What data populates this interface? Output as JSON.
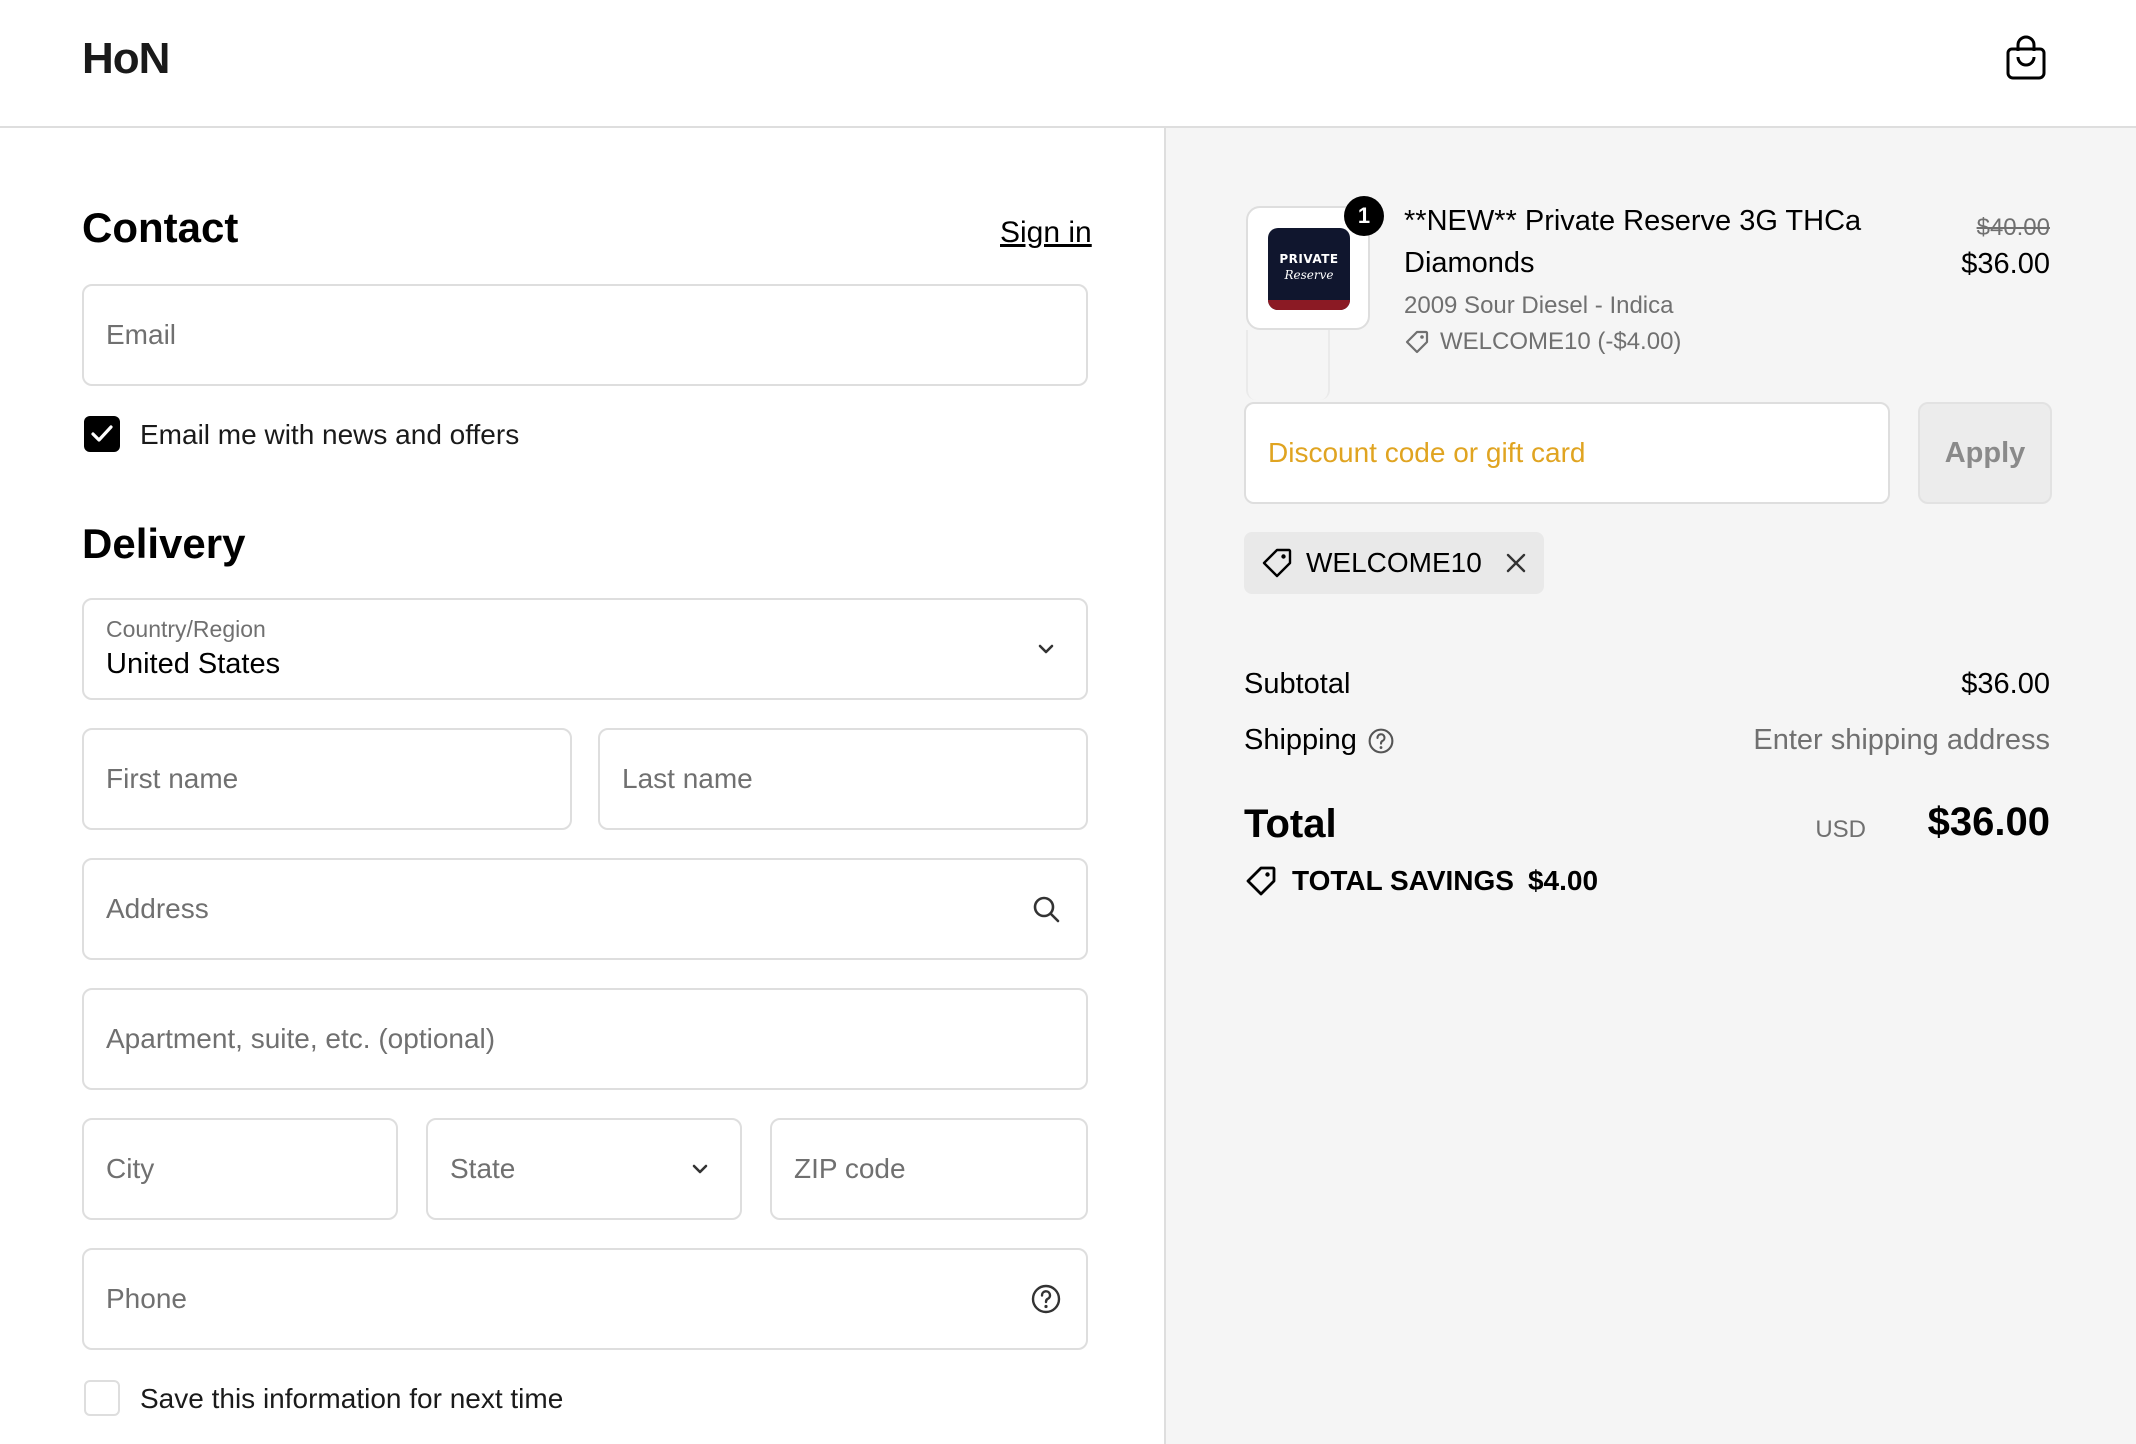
{
  "header": {
    "logo": "HoN",
    "cart_icon": "shopping-bag-icon"
  },
  "contact": {
    "title": "Contact",
    "sign_in_label": "Sign in",
    "email_placeholder": "Email",
    "news_checkbox_label": "Email me with news and offers",
    "news_checked": true
  },
  "delivery": {
    "title": "Delivery",
    "country_label": "Country/Region",
    "country_value": "United States",
    "first_name_placeholder": "First name",
    "last_name_placeholder": "Last name",
    "address_placeholder": "Address",
    "apartment_placeholder": "Apartment, suite, etc. (optional)",
    "city_placeholder": "City",
    "state_placeholder": "State",
    "zip_placeholder": "ZIP code",
    "phone_placeholder": "Phone",
    "save_info_label": "Save this information for next time",
    "save_info_checked": false
  },
  "summary": {
    "product": {
      "quantity": "1",
      "title": "**NEW** Private Reserve 3G THCa Diamonds",
      "variant": "2009 Sour Diesel - Indica",
      "discount": "WELCOME10 (-$4.00)",
      "price_original": "$40.00",
      "price_final": "$36.00",
      "thumb_line1": "PRIVATE",
      "thumb_line2": "Reserve"
    },
    "discount_placeholder": "Discount code or gift card",
    "apply_label": "Apply",
    "applied_code": "WELCOME10",
    "subtotal_label": "Subtotal",
    "subtotal_value": "$36.00",
    "shipping_label": "Shipping",
    "shipping_value": "Enter shipping address",
    "total_label": "Total",
    "total_currency": "USD",
    "total_value": "$36.00",
    "savings_label": "TOTAL SAVINGS",
    "savings_value": "$4.00"
  },
  "colors": {
    "accent_placeholder": "#e0a421",
    "panel_bg": "#f5f5f5",
    "border": "#dedede"
  }
}
